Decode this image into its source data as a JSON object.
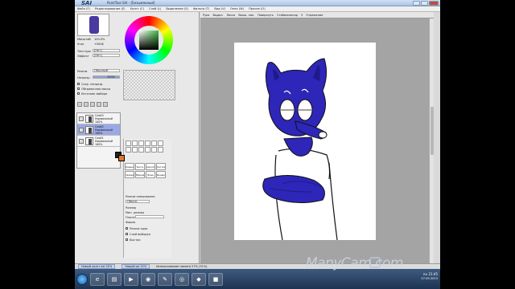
{
  "app": {
    "logo": "SAI",
    "title": "PaintTool SAI - [Безымянный]",
    "menu": [
      "Файл (F)",
      "Редактирование (E)",
      "Холст (C)",
      "Слой (L)",
      "Выделение (S)",
      "Фильтр (T)",
      "Вид (V)",
      "Окно (W)",
      "Прочее (O)"
    ]
  },
  "navigator": {
    "zoom_label": "Масштаб",
    "zoom_value": "100.0%",
    "angle_label": "Угол",
    "angle_value": "+000$"
  },
  "layer_panel": {
    "texture_label": "Текстура",
    "texture_value": "[Нет]",
    "effect_label": "Эффект",
    "effect_value": "[Нет]",
    "opacity_label": "Непрозр.",
    "mode_label": "Режим",
    "mode_value": "Обычный",
    "opacity_value": "100%",
    "options": [
      "Сохр. непрозр.",
      "Обтравочная маска",
      "Источник выбора"
    ],
    "layers": [
      {
        "name": "Слой3",
        "mode": "Нормальный",
        "opacity": "100%"
      },
      {
        "name": "Слой2",
        "mode": "Нормальный",
        "opacity": "100%"
      },
      {
        "name": "Слой1",
        "mode": "Нормальный",
        "opacity": "100%"
      }
    ]
  },
  "tools": {
    "brush_labels": [
      "Карандаш",
      "Кисть",
      "Аэрограф",
      "Ластик",
      "Заливка",
      "Маркер",
      "Вода",
      "Бинарник"
    ],
    "settings": [
      "Режим смешивания",
      "Обычн.",
      "Размер",
      "Мин. размер",
      "Плотность",
      "Форма"
    ],
    "checkboxes": [
      "Резкие края",
      "Слой выборки",
      "Быстро"
    ],
    "foreground_color": "#222222",
    "background_color": "#e2762b"
  },
  "canvas": {
    "tabs": [
      "Рука",
      "Выдел.",
      "Лассо",
      "Волш. пал.",
      "Повернуть",
      "Стабилизатор",
      "Отражение"
    ],
    "stabilizer_value": "3"
  },
  "status": {
    "doc_tab": "Новый холст.sai",
    "doc_zoom": "22%",
    "doc_tab2": "Новый.sai",
    "doc_zoom2": "22%",
    "memory": "Использование памяти 27% (31%)"
  },
  "taskbar": {
    "apps": [
      "ie",
      "folder",
      "media",
      "chrome",
      "sai",
      "manycam",
      "paint",
      "player"
    ],
    "lang": "RU",
    "time": "21:45",
    "date": "07.09.2015"
  },
  "watermark": "ManyCam.com",
  "colors": {
    "fur": "#2d26b8",
    "fur_shadow": "#1f1a8a",
    "accent": "#e2762b"
  }
}
